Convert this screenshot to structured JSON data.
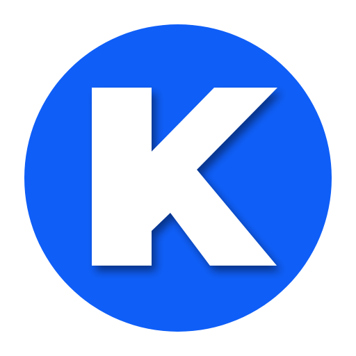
{
  "logo": {
    "letter": "K",
    "colors": {
      "background": "#ffffff",
      "circle": "#0f5ef7",
      "letter": "#ffffff",
      "shadow": "#0b2f8a"
    }
  }
}
